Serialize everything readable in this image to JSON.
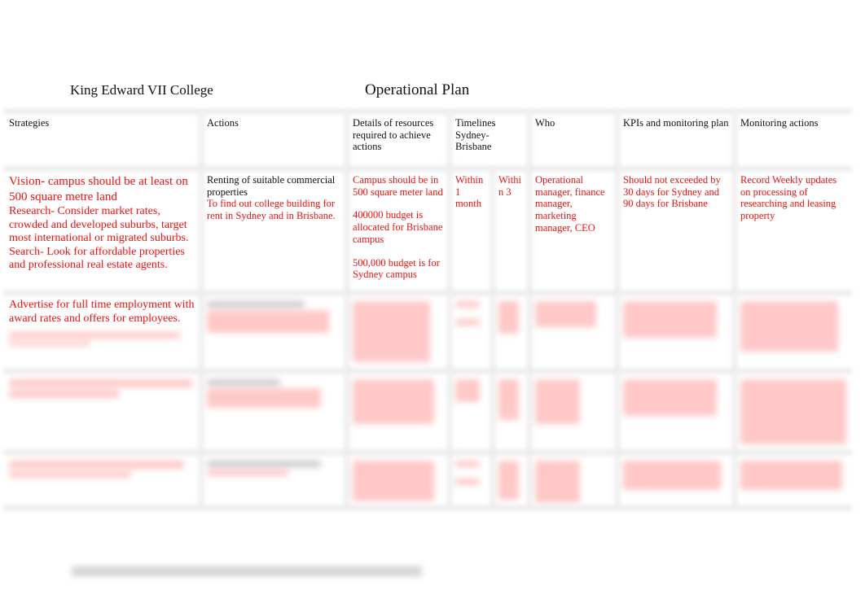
{
  "header": {
    "org_name": "King Edward VII College",
    "doc_title": "Operational Plan"
  },
  "table": {
    "columns": [
      "Strategies",
      "Actions",
      "Details of resources required to achieve actions",
      "Timelines Sydney-Brisbane",
      "",
      "Who",
      "KPIs and monitoring plan",
      "Monitoring actions"
    ],
    "rows": [
      {
        "strategy": {
          "vision": "Vision- campus should be at least on 500 square metre land",
          "research": "Research- Consider market rates, crowded and developed suburbs, target most international or migrated suburbs.",
          "search": "Search- Look for affordable properties and professional real estate agents."
        },
        "action": {
          "title": "Renting of suitable commercial properties",
          "detail": "To find out college building for rent in Sydney and in Brisbane."
        },
        "resources": [
          "Campus should be in 500 square meter land",
          "400000 budget is allocated for Brisbane campus",
          "500,000 budget is for Sydney campus"
        ],
        "timeline_sydney": "Within 1 month",
        "timeline_brisbane": "Within 3",
        "who": "Operational manager, finance manager, marketing manager, CEO",
        "kpi": "Should not exceeded by 30 days for Sydney and 90 days for Brisbane",
        "monitoring": "Record Weekly updates on processing of researching and leasing property"
      },
      {
        "strategy": {
          "main": "Advertise for full time employment with award rates and offers for employees."
        },
        "obscured": true
      },
      {
        "obscured": true
      },
      {
        "obscured": true
      }
    ]
  },
  "footer": {
    "obscured": true
  },
  "colors": {
    "accent_red": "#ee1111",
    "text_dark": "#111111",
    "grid_line": "#e9e9e9"
  }
}
